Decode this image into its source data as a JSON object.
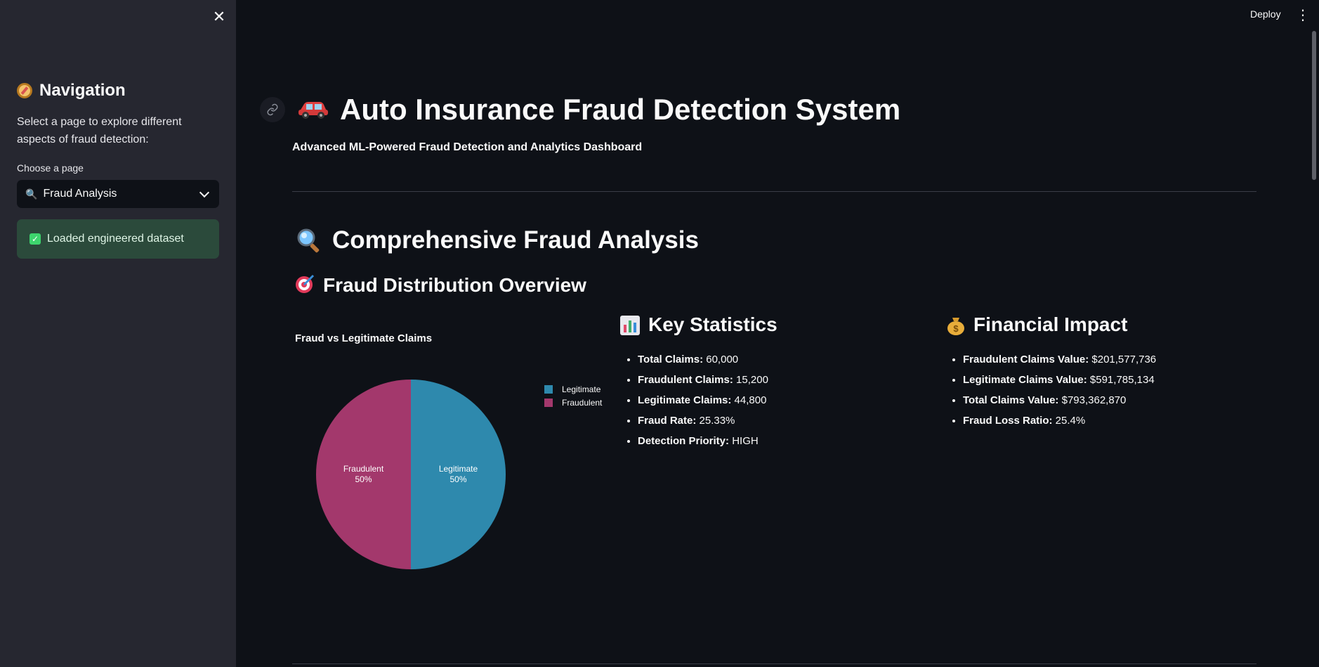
{
  "sidebar": {
    "nav_title": "Navigation",
    "description": "Select a page to explore different aspects of fraud detection:",
    "select_label": "Choose a page",
    "selected_page": "Fraud Analysis",
    "success_message": "Loaded engineered dataset"
  },
  "header": {
    "deploy_label": "Deploy"
  },
  "main": {
    "title": "Auto Insurance Fraud Detection System",
    "subtitle": "Advanced ML-Powered Fraud Detection and Analytics Dashboard",
    "section_title": "Comprehensive Fraud Analysis",
    "subsection_title": "Fraud Distribution Overview",
    "key_stats": {
      "title": "Key Statistics",
      "items": [
        {
          "label": "Total Claims:",
          "value": "60,000"
        },
        {
          "label": "Fraudulent Claims:",
          "value": "15,200"
        },
        {
          "label": "Legitimate Claims:",
          "value": "44,800"
        },
        {
          "label": "Fraud Rate:",
          "value": "25.33%"
        },
        {
          "label": "Detection Priority:",
          "value": "HIGH"
        }
      ]
    },
    "financial": {
      "title": "Financial Impact",
      "items": [
        {
          "label": "Fraudulent Claims Value:",
          "value": "$201,577,736"
        },
        {
          "label": "Legitimate Claims Value:",
          "value": "$591,785,134"
        },
        {
          "label": "Total Claims Value:",
          "value": "$793,362,870"
        },
        {
          "label": "Fraud Loss Ratio:",
          "value": "25.4%"
        }
      ]
    }
  },
  "chart_data": {
    "type": "pie",
    "title": "Fraud vs Legitimate Claims",
    "categories": [
      "Legitimate",
      "Fraudulent"
    ],
    "values": [
      50,
      50
    ],
    "labels": [
      "50%",
      "50%"
    ],
    "colors": [
      "#2e89ad",
      "#a3386c"
    ],
    "legend": "top-right"
  },
  "colors": {
    "background": "#0e1117",
    "sidebar": "#262730",
    "success_bg": "#2b4a3b"
  },
  "icons": {
    "close": "close-icon",
    "compass": "compass-icon",
    "search": "magnifier-icon",
    "check": "checkbox-icon",
    "link": "link-icon",
    "car": "car-icon",
    "target": "target-icon",
    "chart": "bar-chart-icon",
    "money": "money-bag-icon",
    "menu": "kebab-menu-icon"
  }
}
